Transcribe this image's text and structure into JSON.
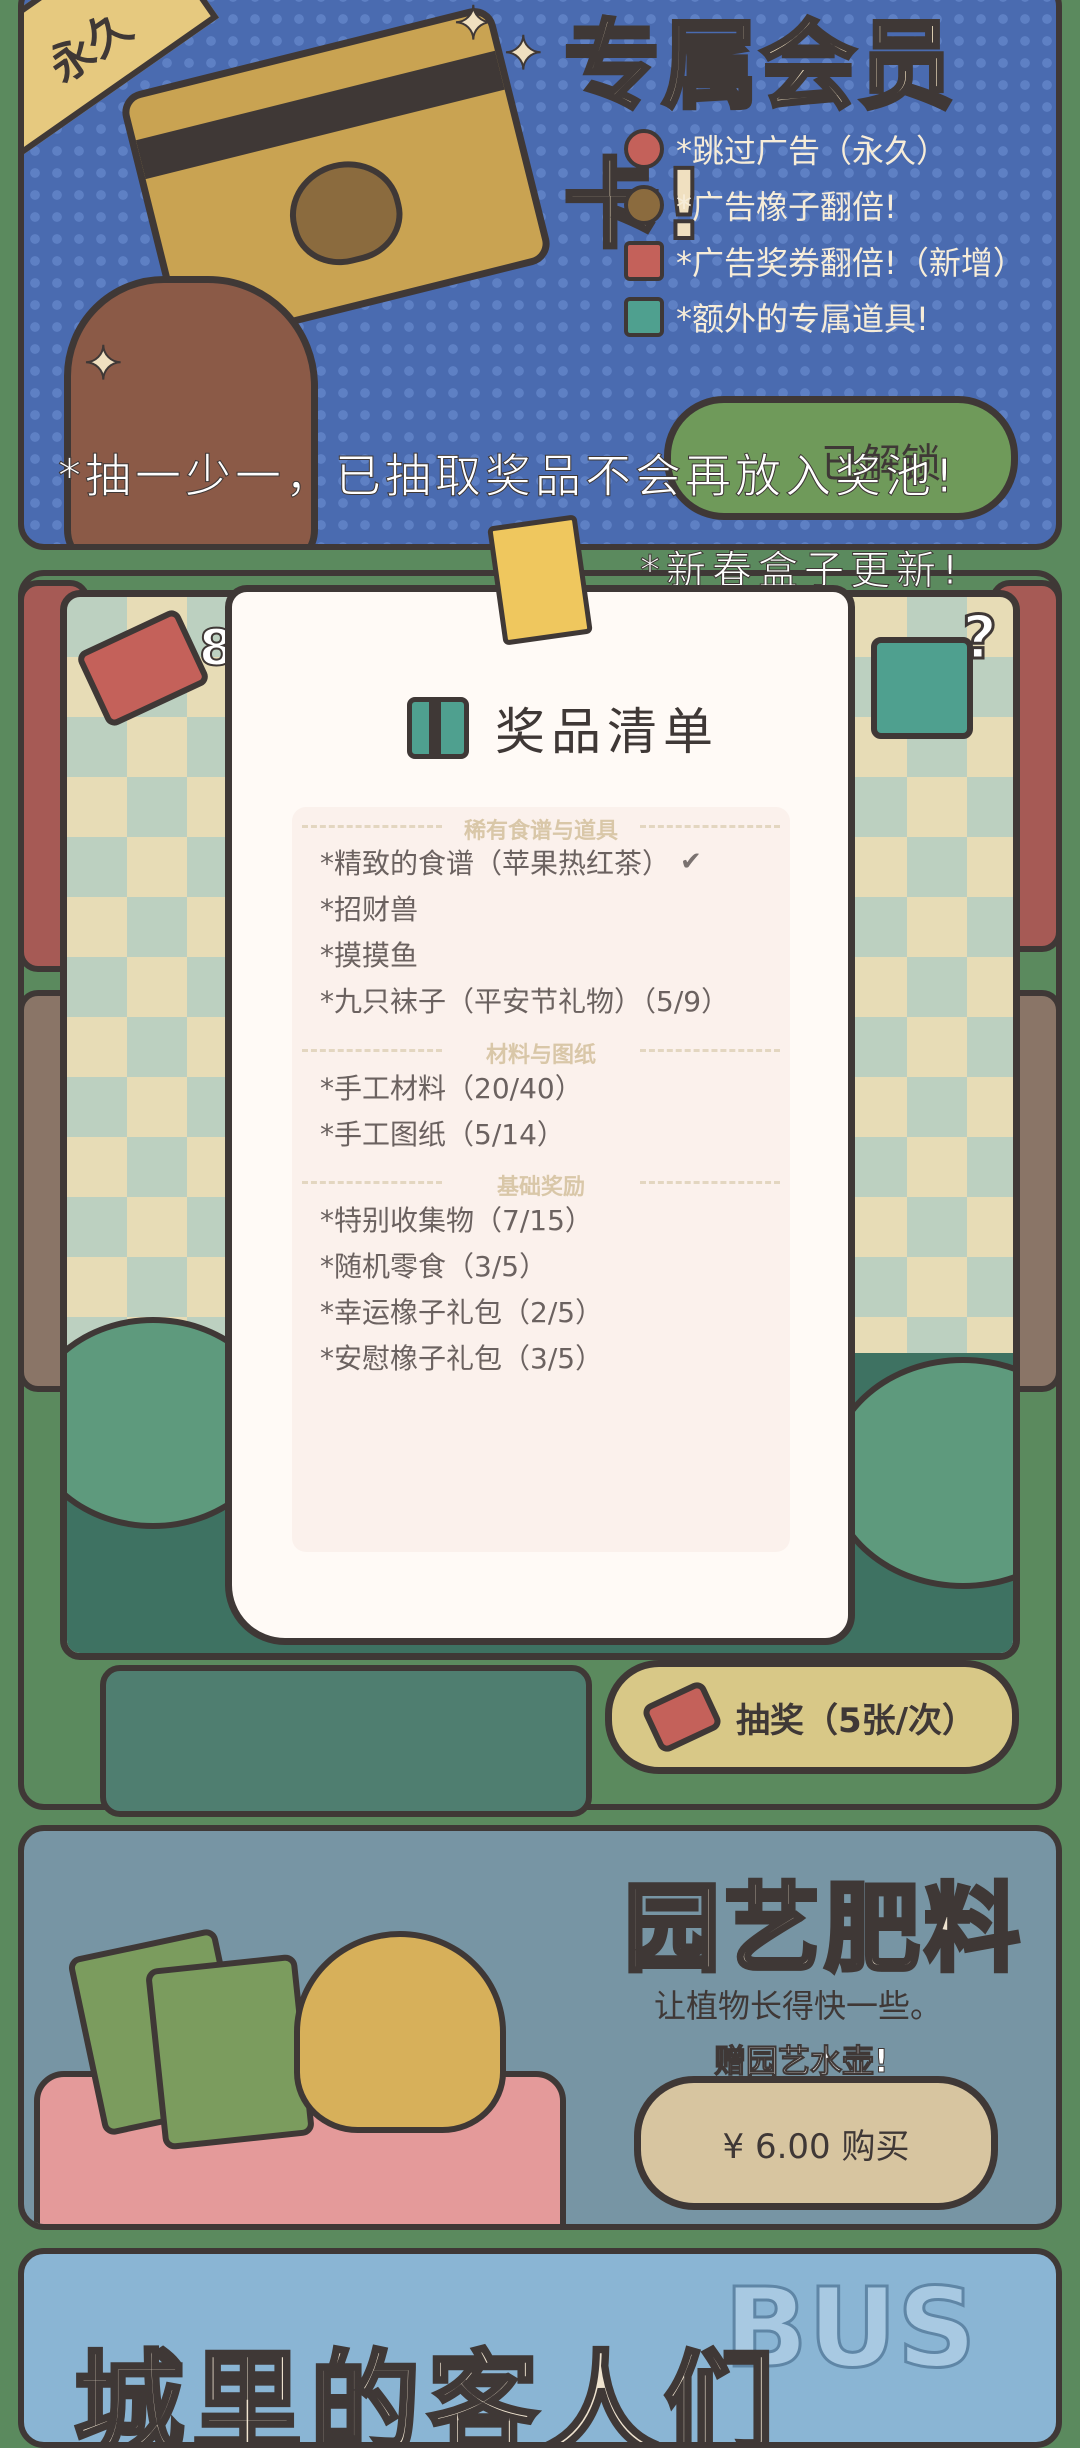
{
  "member": {
    "ribbon_text": "永久",
    "title": "专属会员卡!",
    "features": [
      {
        "icon": "no-ads-icon",
        "text": "*跳过广告（永久）"
      },
      {
        "icon": "acorn-icon",
        "text": "*广告橡子翻倍!"
      },
      {
        "icon": "ticket-icon",
        "text": "*广告奖券翻倍!（新增）"
      },
      {
        "icon": "gift-icon",
        "text": "*额外的专属道具!"
      }
    ],
    "unlocked_label": "已解锁"
  },
  "notes": {
    "draw_once": "*抽一少一，已抽取奖品不会再放入奖池!",
    "new_year": "*新春盒子更新!"
  },
  "lottery": {
    "ticket_count": "8",
    "mystery_mark": "?",
    "draw_button": "抽奖（5张/次）"
  },
  "prize_list": {
    "title": "奖品清单",
    "sections": [
      {
        "name": "稀有食谱与道具",
        "items": [
          "*精致的食谱（苹果热红茶）",
          "*招财兽",
          "*摸摸鱼",
          "*九只袜子（平安节礼物）（5/9）"
        ]
      },
      {
        "name": "材料与图纸",
        "items": [
          "*手工材料（20/40）",
          "*手工图纸（5/14）"
        ]
      },
      {
        "name": "基础奖励",
        "items": [
          "*特别收集物（7/15）",
          "*随机零食（3/5）",
          "*幸运橡子礼包（2/5）",
          "*安慰橡子礼包（3/5）"
        ]
      }
    ],
    "checked_item": "*精致的食谱（苹果热红茶）"
  },
  "fertilizer": {
    "title": "园艺肥料",
    "subtitle": "让植物长得快一些。",
    "gift_note": "赠园艺水壶!",
    "buy_label": "¥ 6.00 购买"
  },
  "guests": {
    "title": "城里的客人们",
    "sign": "BUS"
  },
  "colors": {
    "outline": "#3f3836",
    "member_bg": "#4a6bb0",
    "paper": "#fffaf6",
    "button": "#d8c887"
  }
}
